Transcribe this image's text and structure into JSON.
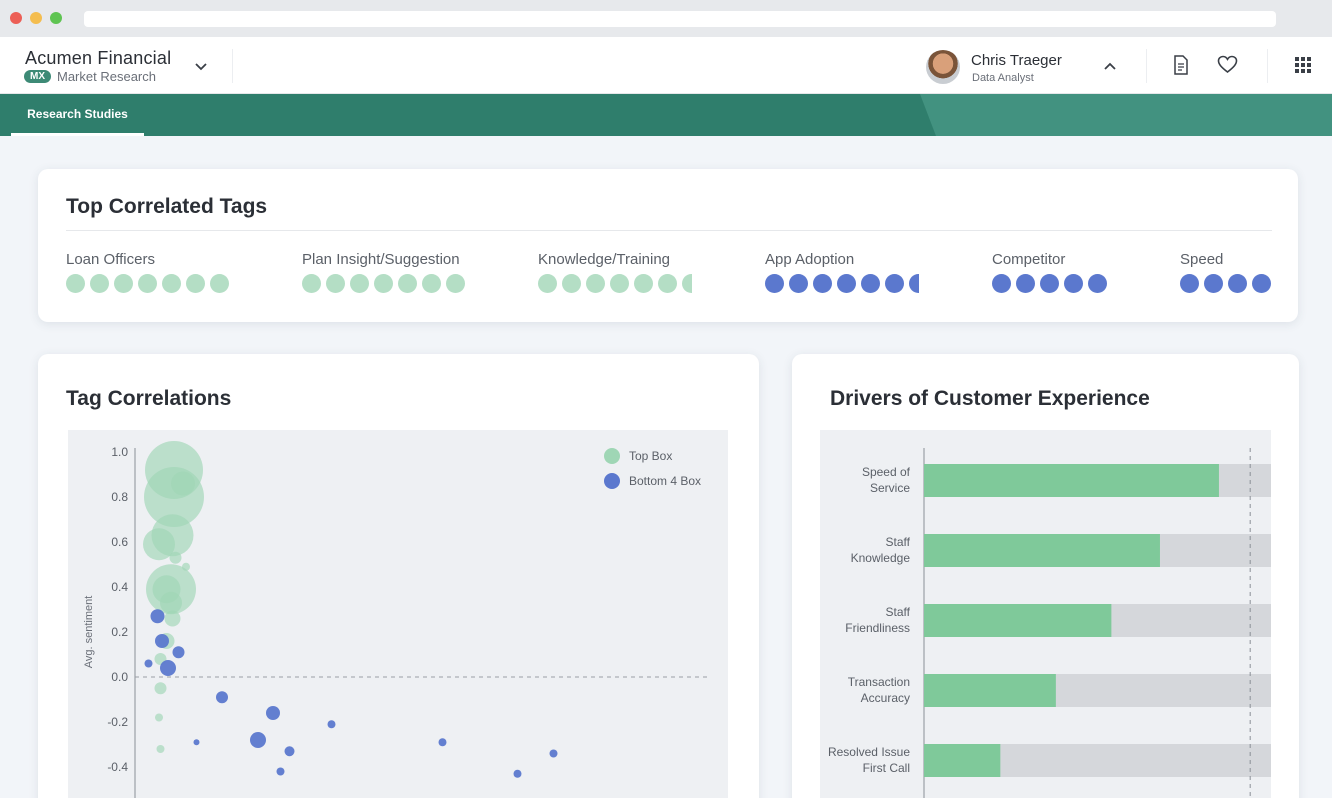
{
  "header": {
    "company": "Acumen Financial",
    "badge": "MX",
    "subtitle": "Market Research",
    "user_name": "Chris Traeger",
    "user_role": "Data Analyst"
  },
  "nav": {
    "active_tab": "Research Studies"
  },
  "colors": {
    "top_box": "#9fd6b5",
    "bottom_box": "#5b78ce",
    "brand": "#2f7e6c",
    "bar_green": "#7fc99a",
    "bar_track": "#d5d7db"
  },
  "top_tags": {
    "title": "Top Correlated Tags",
    "tags": [
      {
        "label": "Loan Officers",
        "dots": 7,
        "color": "green"
      },
      {
        "label": "Plan Insight/Suggestion",
        "dots": 7,
        "color": "green"
      },
      {
        "label": "Knowledge/Training",
        "dots": 7,
        "color": "green"
      },
      {
        "label": "App Adoption",
        "dots": 7,
        "color": "blue"
      },
      {
        "label": "Competitor",
        "dots": 5,
        "color": "blue"
      },
      {
        "label": "Speed",
        "dots": 4,
        "color": "blue"
      }
    ]
  },
  "tag_correlations": {
    "title": "Tag Correlations",
    "legend": [
      "Top Box",
      "Bottom 4 Box"
    ]
  },
  "drivers": {
    "title": "Drivers of Customer Experience"
  },
  "chart_data": [
    {
      "type": "scatter",
      "title": "Tag Correlations",
      "ylabel": "Avg. sentiment",
      "xlabel": "",
      "ylim": [
        -0.45,
        1.1
      ],
      "yticks": [
        "1.0",
        "0.8",
        "0.6",
        "0.4",
        "0.2",
        "0.0",
        "-0.2",
        "-0.4"
      ],
      "legend_position": "top-right",
      "series": [
        {
          "name": "Top Box",
          "points": [
            {
              "x": 0.26,
              "y": 0.92,
              "r": 29
            },
            {
              "x": 0.26,
              "y": 0.8,
              "r": 30
            },
            {
              "x": 0.32,
              "y": 0.86,
              "r": 12
            },
            {
              "x": 0.25,
              "y": 0.63,
              "r": 21
            },
            {
              "x": 0.16,
              "y": 0.59,
              "r": 16
            },
            {
              "x": 0.27,
              "y": 0.53,
              "r": 6
            },
            {
              "x": 0.34,
              "y": 0.49,
              "r": 4
            },
            {
              "x": 0.24,
              "y": 0.39,
              "r": 25
            },
            {
              "x": 0.21,
              "y": 0.39,
              "r": 14
            },
            {
              "x": 0.24,
              "y": 0.33,
              "r": 11
            },
            {
              "x": 0.25,
              "y": 0.26,
              "r": 8
            },
            {
              "x": 0.21,
              "y": 0.16,
              "r": 8
            },
            {
              "x": 0.17,
              "y": 0.08,
              "r": 6
            },
            {
              "x": 0.17,
              "y": -0.05,
              "r": 6
            },
            {
              "x": 0.16,
              "y": -0.18,
              "r": 4
            },
            {
              "x": 0.17,
              "y": -0.32,
              "r": 4
            }
          ]
        },
        {
          "name": "Bottom 4 Box",
          "points": [
            {
              "x": 0.15,
              "y": 0.27,
              "r": 7
            },
            {
              "x": 0.18,
              "y": 0.16,
              "r": 7
            },
            {
              "x": 0.29,
              "y": 0.11,
              "r": 6
            },
            {
              "x": 0.22,
              "y": 0.04,
              "r": 8
            },
            {
              "x": 0.09,
              "y": 0.06,
              "r": 4
            },
            {
              "x": 0.58,
              "y": -0.09,
              "r": 6
            },
            {
              "x": 0.92,
              "y": -0.16,
              "r": 7
            },
            {
              "x": 1.31,
              "y": -0.21,
              "r": 4
            },
            {
              "x": 0.82,
              "y": -0.28,
              "r": 8
            },
            {
              "x": 0.41,
              "y": -0.29,
              "r": 3
            },
            {
              "x": 1.03,
              "y": -0.33,
              "r": 5
            },
            {
              "x": 2.05,
              "y": -0.29,
              "r": 4
            },
            {
              "x": 2.79,
              "y": -0.34,
              "r": 4
            },
            {
              "x": 0.97,
              "y": -0.42,
              "r": 4
            },
            {
              "x": 2.55,
              "y": -0.43,
              "r": 4
            }
          ]
        }
      ]
    },
    {
      "type": "bar",
      "orientation": "horizontal",
      "title": "Drivers of Customer Experience",
      "categories": [
        [
          "Speed of",
          "Service"
        ],
        [
          "Staff",
          "Knowledge"
        ],
        [
          "Staff",
          "Friendliness"
        ],
        [
          "Transaction",
          "Accuracy"
        ],
        [
          "Resolved Issue",
          "First Call"
        ]
      ],
      "values": [
        0.85,
        0.68,
        0.54,
        0.38,
        0.22
      ],
      "xlim": [
        0,
        1
      ],
      "reference_line": 0.94
    }
  ]
}
